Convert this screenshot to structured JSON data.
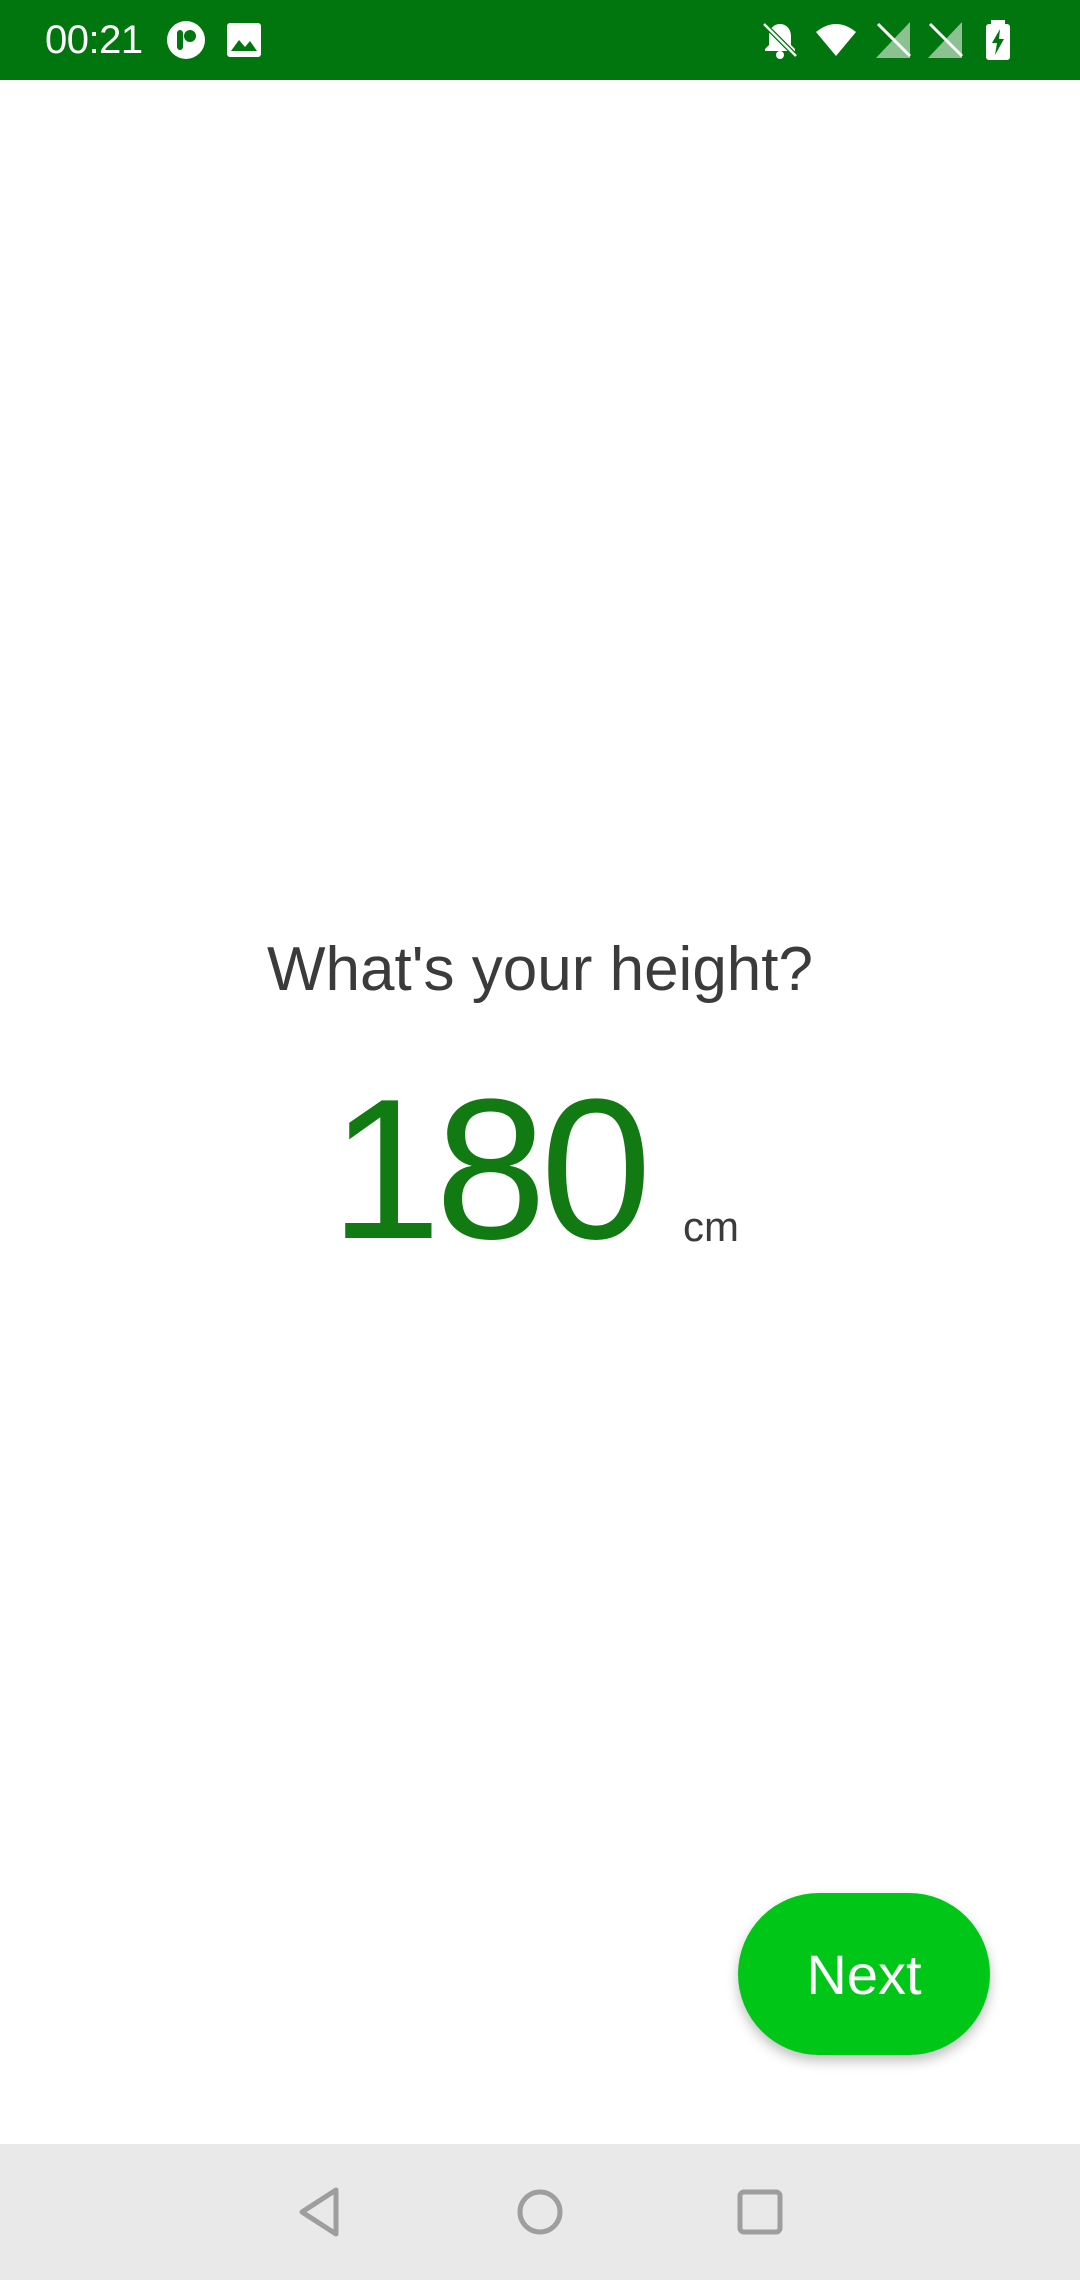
{
  "status_bar": {
    "time": "00:21",
    "background_color": "#01760e",
    "left_icons": [
      "app-notification-icon",
      "image-icon"
    ],
    "right_icons": [
      "notifications-off-icon",
      "wifi-icon",
      "no-sim-icon",
      "no-sim-icon",
      "battery-charging-icon"
    ]
  },
  "main": {
    "question": "What's your height?",
    "height_value": "180",
    "height_unit": "cm",
    "value_color": "#127a12"
  },
  "actions": {
    "next_label": "Next",
    "next_color": "#00c717"
  },
  "nav_bar": {
    "buttons": [
      "back-icon",
      "home-icon",
      "recents-icon"
    ]
  }
}
